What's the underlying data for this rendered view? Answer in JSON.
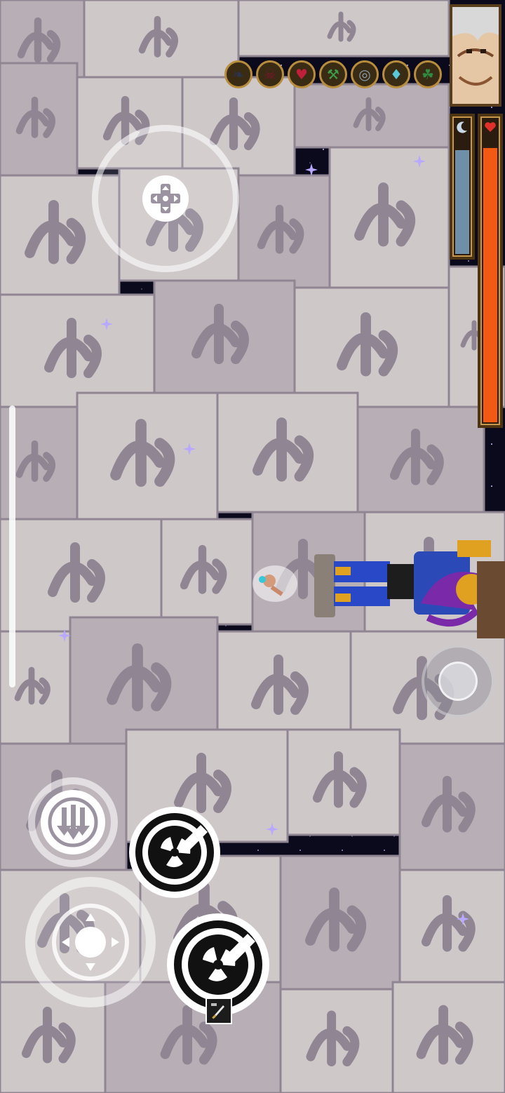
{
  "hud": {
    "items": [
      {
        "icon": "crow-icon",
        "color": "#2a3550"
      },
      {
        "icon": "skull-mask-icon",
        "color": "#7a1630"
      },
      {
        "icon": "ruby-amulet-icon",
        "color": "#c0203a"
      },
      {
        "icon": "green-hammer-icon",
        "color": "#3aa04a"
      },
      {
        "icon": "chain-ring-icon",
        "color": "#8aa0b0"
      },
      {
        "icon": "crystal-cluster-icon",
        "color": "#58c8d8"
      },
      {
        "icon": "green-leaf-icon",
        "color": "#2f8a40"
      }
    ],
    "mana": {
      "level": 0.86,
      "color": "#6f8fa8",
      "icon": "moon-icon"
    },
    "health": {
      "level": 0.95,
      "color": "#f25a14",
      "icon": "heart-icon"
    }
  },
  "controls": {
    "dpad_icon": "dpad-cross-icon",
    "dash_icon": "down-arrows-icon",
    "attack_icon": "crosshair-icon",
    "skill_icon": "triskelion-icon",
    "skill_badge_icon": "sword-scroll-icon"
  },
  "colors": {
    "wall_light": "#cfc8c9",
    "wall_mid": "#b8aeb5",
    "wall_shadow": "#8f8593",
    "space": "#0b0a1c",
    "enemy_blue": "#2848c8",
    "enemy_gold": "#e0a020",
    "enemy_purple": "#7a2aa8"
  }
}
